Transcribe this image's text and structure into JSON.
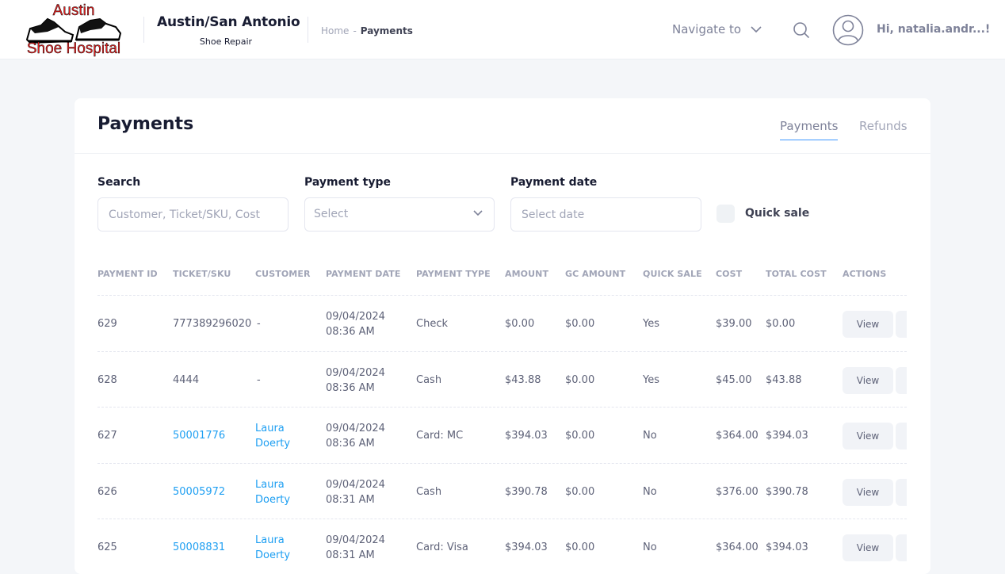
{
  "header": {
    "logo_line1": "Austin",
    "logo_line2": "Shoe Hospital",
    "brand_title": "Austin/San Antonio",
    "brand_subtitle": "Shoe Repair",
    "breadcrumb": {
      "home": "Home",
      "separator": "-",
      "current": "Payments"
    },
    "navigate_label": "Navigate to",
    "greeting": "Hi, natalia.andr...!",
    "icons": {
      "navigate": "chevron-down-icon",
      "search": "search-icon",
      "user": "user-avatar-icon"
    }
  },
  "page": {
    "title": "Payments",
    "tabs": [
      {
        "label": "Payments",
        "active": true
      },
      {
        "label": "Refunds",
        "active": false
      }
    ]
  },
  "filters": {
    "search": {
      "label": "Search",
      "placeholder": "Customer, Ticket/SKU, Cost"
    },
    "payment_type": {
      "label": "Payment type",
      "placeholder": "Select"
    },
    "payment_date": {
      "label": "Payment date",
      "placeholder": "Select date"
    },
    "quick_sale": {
      "label": "Quick sale",
      "checked": false
    }
  },
  "table": {
    "columns": [
      "PAYMENT ID",
      "TICKET/SKU",
      "CUSTOMER",
      "PAYMENT DATE",
      "PAYMENT TYPE",
      "AMOUNT",
      "GC AMOUNT",
      "QUICK SALE",
      "COST",
      "TOTAL COST",
      "ACTIONS"
    ],
    "rows": [
      {
        "payment_id": "629",
        "ticket": "777389296020",
        "ticket_is_link": false,
        "customer_first": "-",
        "customer_last": "",
        "customer_is_link": false,
        "date": "09/04/2024",
        "time": "08:36 AM",
        "payment_type": "Check",
        "amount": "$0.00",
        "gc_amount": "$0.00",
        "quick_sale": "Yes",
        "cost": "$39.00",
        "total_cost": "$0.00",
        "action": "View"
      },
      {
        "payment_id": "628",
        "ticket": "4444",
        "ticket_is_link": false,
        "customer_first": "-",
        "customer_last": "",
        "customer_is_link": false,
        "date": "09/04/2024",
        "time": "08:36 AM",
        "payment_type": "Cash",
        "amount": "$43.88",
        "gc_amount": "$0.00",
        "quick_sale": "Yes",
        "cost": "$45.00",
        "total_cost": "$43.88",
        "action": "View"
      },
      {
        "payment_id": "627",
        "ticket": "50001776",
        "ticket_is_link": true,
        "customer_first": "Laura",
        "customer_last": "Doerty",
        "customer_is_link": true,
        "date": "09/04/2024",
        "time": "08:36 AM",
        "payment_type": "Card: MC",
        "amount": "$394.03",
        "gc_amount": "$0.00",
        "quick_sale": "No",
        "cost": "$364.00",
        "total_cost": "$394.03",
        "action": "View"
      },
      {
        "payment_id": "626",
        "ticket": "50005972",
        "ticket_is_link": true,
        "customer_first": "Laura",
        "customer_last": "Doerty",
        "customer_is_link": true,
        "date": "09/04/2024",
        "time": "08:31 AM",
        "payment_type": "Cash",
        "amount": "$390.78",
        "gc_amount": "$0.00",
        "quick_sale": "No",
        "cost": "$376.00",
        "total_cost": "$390.78",
        "action": "View"
      },
      {
        "payment_id": "625",
        "ticket": "50008831",
        "ticket_is_link": true,
        "customer_first": "Laura",
        "customer_last": "Doerty",
        "customer_is_link": true,
        "date": "09/04/2024",
        "time": "08:31 AM",
        "payment_type": "Card: Visa",
        "amount": "$394.03",
        "gc_amount": "$0.00",
        "quick_sale": "No",
        "cost": "$364.00",
        "total_cost": "$394.03",
        "action": "View"
      }
    ]
  },
  "colors": {
    "accent": "#3e97ff",
    "link": "#1e9ff2",
    "logo_red": "#e41f1f"
  }
}
